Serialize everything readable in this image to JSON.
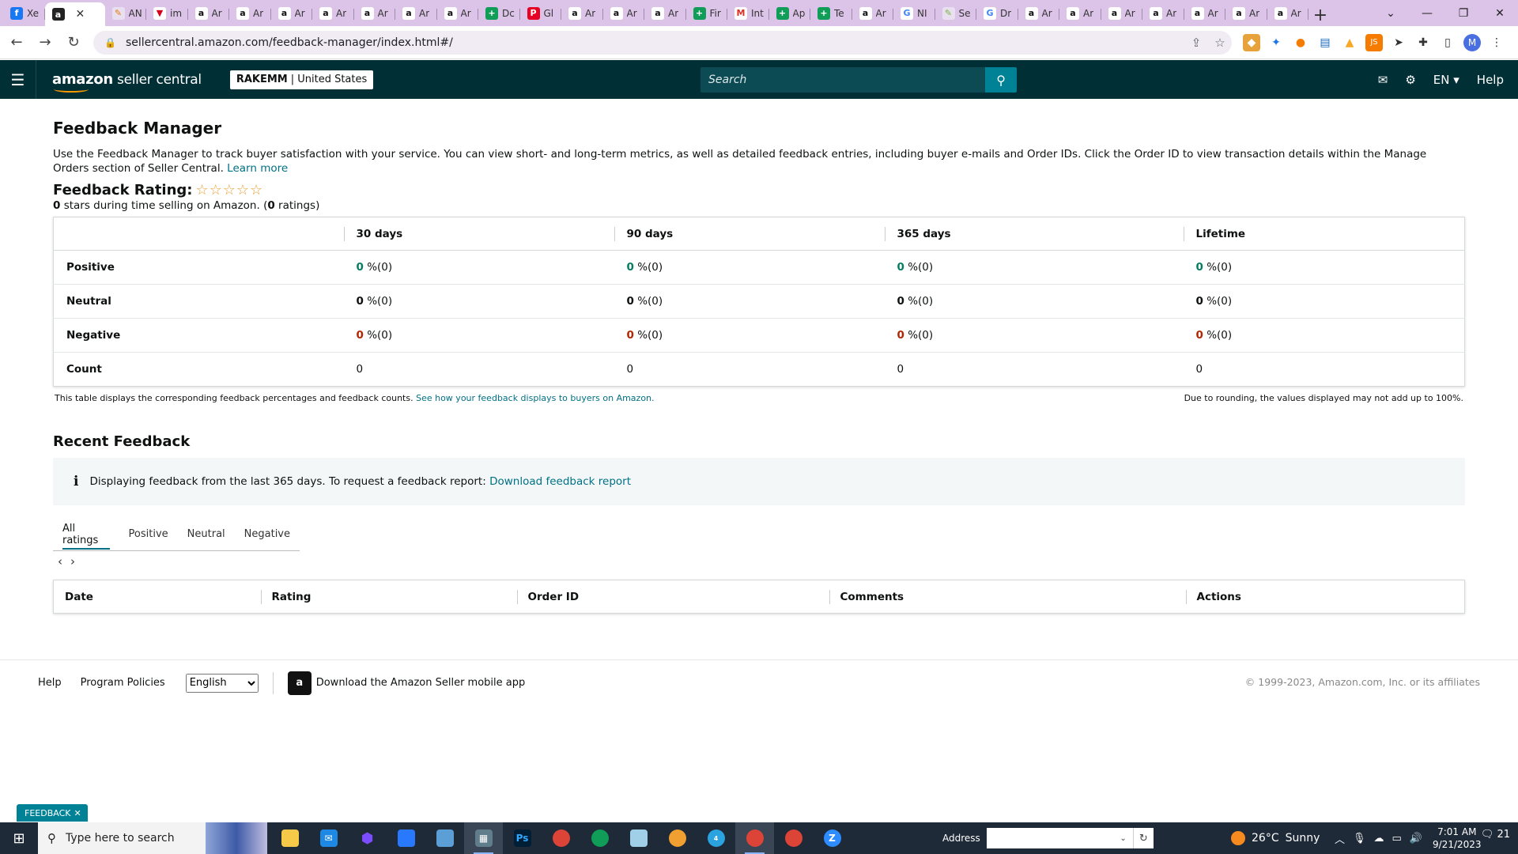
{
  "browser": {
    "tabs": [
      {
        "label": "Xe",
        "icon": "f",
        "bg": "#1877f2",
        "fg": "#fff"
      },
      {
        "label": "",
        "icon": "a",
        "bg": "#222",
        "fg": "#fff",
        "active": true
      },
      {
        "label": "AN",
        "icon": "✎",
        "bg": "#e8e0f0",
        "fg": "#e47911"
      },
      {
        "label": "im",
        "icon": "▼",
        "bg": "#fff",
        "fg": "#d4001b"
      },
      {
        "label": "Ar",
        "icon": "a",
        "bg": "#fff",
        "fg": "#111"
      },
      {
        "label": "Ar",
        "icon": "a",
        "bg": "#fff",
        "fg": "#111"
      },
      {
        "label": "Ar",
        "icon": "a",
        "bg": "#fff",
        "fg": "#111"
      },
      {
        "label": "Ar",
        "icon": "a",
        "bg": "#fff",
        "fg": "#111"
      },
      {
        "label": "Ar",
        "icon": "a",
        "bg": "#fff",
        "fg": "#111"
      },
      {
        "label": "Ar",
        "icon": "a",
        "bg": "#fff",
        "fg": "#111"
      },
      {
        "label": "Ar",
        "icon": "a",
        "bg": "#fff",
        "fg": "#111"
      },
      {
        "label": "Dc",
        "icon": "+",
        "bg": "#0f9d58",
        "fg": "#fff"
      },
      {
        "label": "Gl",
        "icon": "P",
        "bg": "#e60023",
        "fg": "#fff"
      },
      {
        "label": "Ar",
        "icon": "a",
        "bg": "#fff",
        "fg": "#111"
      },
      {
        "label": "Ar",
        "icon": "a",
        "bg": "#fff",
        "fg": "#111"
      },
      {
        "label": "Ar",
        "icon": "a",
        "bg": "#fff",
        "fg": "#111"
      },
      {
        "label": "Fir",
        "icon": "+",
        "bg": "#0f9d58",
        "fg": "#fff"
      },
      {
        "label": "Int",
        "icon": "M",
        "bg": "#fff",
        "fg": "#d93025"
      },
      {
        "label": "Ap",
        "icon": "+",
        "bg": "#0f9d58",
        "fg": "#fff"
      },
      {
        "label": "Te",
        "icon": "+",
        "bg": "#0f9d58",
        "fg": "#fff"
      },
      {
        "label": "Ar",
        "icon": "a",
        "bg": "#fff",
        "fg": "#111"
      },
      {
        "label": "NI",
        "icon": "G",
        "bg": "#fff",
        "fg": "#4285f4"
      },
      {
        "label": "Se",
        "icon": "✎",
        "bg": "#e8e0f0",
        "fg": "#7cb342"
      },
      {
        "label": "Dr",
        "icon": "G",
        "bg": "#fff",
        "fg": "#4285f4"
      },
      {
        "label": "Ar",
        "icon": "a",
        "bg": "#fff",
        "fg": "#111"
      },
      {
        "label": "Ar",
        "icon": "a",
        "bg": "#fff",
        "fg": "#111"
      },
      {
        "label": "Ar",
        "icon": "a",
        "bg": "#fff",
        "fg": "#111"
      },
      {
        "label": "Ar",
        "icon": "a",
        "bg": "#fff",
        "fg": "#111"
      },
      {
        "label": "Ar",
        "icon": "a",
        "bg": "#fff",
        "fg": "#111"
      },
      {
        "label": "Ar",
        "icon": "a",
        "bg": "#fff",
        "fg": "#111"
      },
      {
        "label": "Ar",
        "icon": "a",
        "bg": "#fff",
        "fg": "#111"
      }
    ],
    "url": "sellercentral.amazon.com/feedback-manager/index.html#/",
    "profile_initial": "M"
  },
  "header": {
    "logo_bold": "amazon",
    "logo_rest": " seller central",
    "store_name": "RAKEMM",
    "store_region": "| United States",
    "search_placeholder": "Search",
    "language": "EN",
    "help": "Help"
  },
  "page": {
    "title": "Feedback Manager",
    "description": "Use the Feedback Manager to track buyer satisfaction with your service. You can view short- and long-term metrics, as well as detailed feedback entries, including buyer e-mails and Order IDs. Click the Order ID to view transaction details within the Manage Orders section of Seller Central.",
    "learn_more": "Learn more",
    "rating_label": "Feedback Rating:",
    "stars_glyphs": "☆☆☆☆☆",
    "stars_value": "0",
    "stars_text": " stars during time selling on Amazon. (",
    "ratings_count": "0",
    "ratings_text": " ratings)"
  },
  "metrics": {
    "columns": [
      "30 days",
      "90 days",
      "365 days",
      "Lifetime"
    ],
    "rows": [
      {
        "label": "Positive",
        "kind": "pos",
        "cells": [
          {
            "v": "0",
            "t": " %(0)"
          },
          {
            "v": "0",
            "t": " %(0)"
          },
          {
            "v": "0",
            "t": " %(0)"
          },
          {
            "v": "0",
            "t": " %(0)"
          }
        ]
      },
      {
        "label": "Neutral",
        "kind": "neu",
        "cells": [
          {
            "v": "0",
            "t": " %(0)"
          },
          {
            "v": "0",
            "t": " %(0)"
          },
          {
            "v": "0",
            "t": " %(0)"
          },
          {
            "v": "0",
            "t": " %(0)"
          }
        ]
      },
      {
        "label": "Negative",
        "kind": "neg",
        "cells": [
          {
            "v": "0",
            "t": " %(0)"
          },
          {
            "v": "0",
            "t": " %(0)"
          },
          {
            "v": "0",
            "t": " %(0)"
          },
          {
            "v": "0",
            "t": " %(0)"
          }
        ]
      },
      {
        "label": "Count",
        "kind": "count",
        "cells": [
          {
            "v": "",
            "t": "0"
          },
          {
            "v": "",
            "t": "0"
          },
          {
            "v": "",
            "t": "0"
          },
          {
            "v": "",
            "t": "0"
          }
        ]
      }
    ],
    "note_left": "This table displays the corresponding feedback percentages and feedback counts.",
    "note_link": "See how your feedback displays to buyers on Amazon.",
    "note_right": "Due to rounding, the values displayed may not add up to 100%."
  },
  "recent": {
    "title": "Recent Feedback",
    "info_text": "Displaying feedback from the last 365 days. To request a feedback report:",
    "info_link": "Download feedback report",
    "tabs": [
      "All ratings",
      "Positive",
      "Neutral",
      "Negative"
    ],
    "columns": [
      "Date",
      "Rating",
      "Order ID",
      "Comments",
      "Actions"
    ]
  },
  "footer": {
    "help": "Help",
    "policies": "Program Policies",
    "language": "English",
    "app_text": "Download the Amazon Seller mobile app",
    "copyright": "© 1999-2023, Amazon.com, Inc. or its affiliates",
    "feedback_tab": "FEEDBACK"
  },
  "taskbar": {
    "search_placeholder": "Type here to search",
    "address_label": "Address",
    "temperature": "26°C",
    "weather": "Sunny",
    "time": "7:01 AM",
    "date": "9/21/2023",
    "notifications": "21",
    "mail_badge": "4"
  },
  "colors": {
    "header_bg": "#002f36",
    "search_btn": "#008296",
    "link": "#007185",
    "positive": "#067d62",
    "negative": "#b12704"
  }
}
